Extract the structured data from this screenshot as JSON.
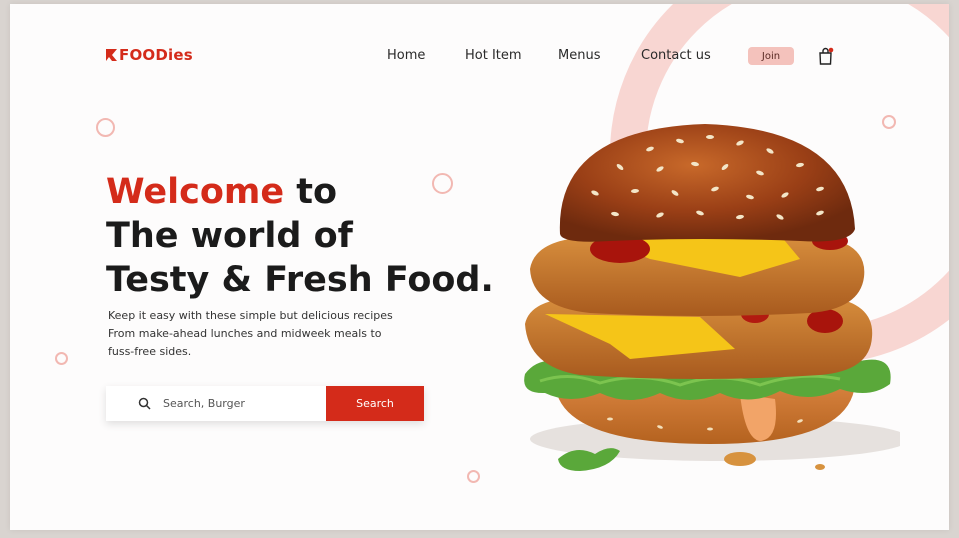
{
  "brand": {
    "name": "FOODies",
    "color": "#d42b1a"
  },
  "nav": {
    "items": [
      {
        "label": "Home"
      },
      {
        "label": "Hot Item"
      },
      {
        "label": "Menus"
      },
      {
        "label": "Contact us"
      }
    ],
    "join_label": "Join",
    "cart_icon": "shopping-bag-icon"
  },
  "hero": {
    "headline_accent": "Welcome",
    "headline_rest": " to",
    "headline_line2": "The world of",
    "headline_line3": "Testy & Fresh Food.",
    "description_line1": "Keep it easy with these simple but delicious recipes",
    "description_line2": "From make-ahead lunches and midweek meals to",
    "description_line3": "fuss-free sides."
  },
  "search": {
    "placeholder": "Search, Burger",
    "button_label": "Search"
  },
  "colors": {
    "accent": "#d42b1a",
    "join_bg": "#f4c2bc",
    "ring": "#f8d6d2"
  }
}
